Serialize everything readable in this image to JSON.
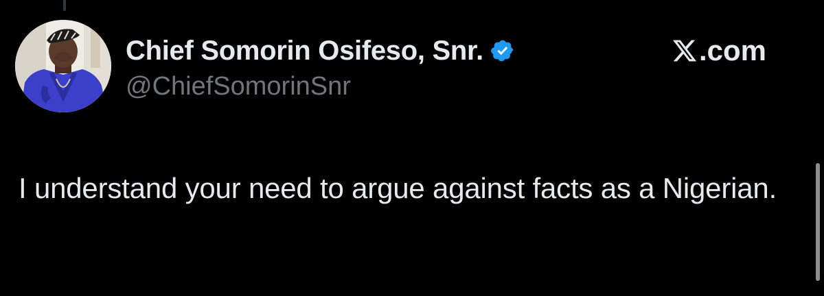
{
  "tweet": {
    "display_name": "Chief Somorin Osifeso, Snr.",
    "handle": "@ChiefSomorinSnr",
    "verified": true,
    "text": "I understand your need to argue against facts as a Nigerian."
  },
  "brand": {
    "icon": "x-logo-icon",
    "text": ".com"
  },
  "colors": {
    "background": "#000000",
    "primary_text": "#e7e9ea",
    "secondary_text": "#71767b",
    "verified_badge": "#1d9bf0",
    "scrollbar": "#8e8e8e"
  },
  "icons": {
    "verified": "verified-badge-icon",
    "avatar": "profile-avatar"
  }
}
